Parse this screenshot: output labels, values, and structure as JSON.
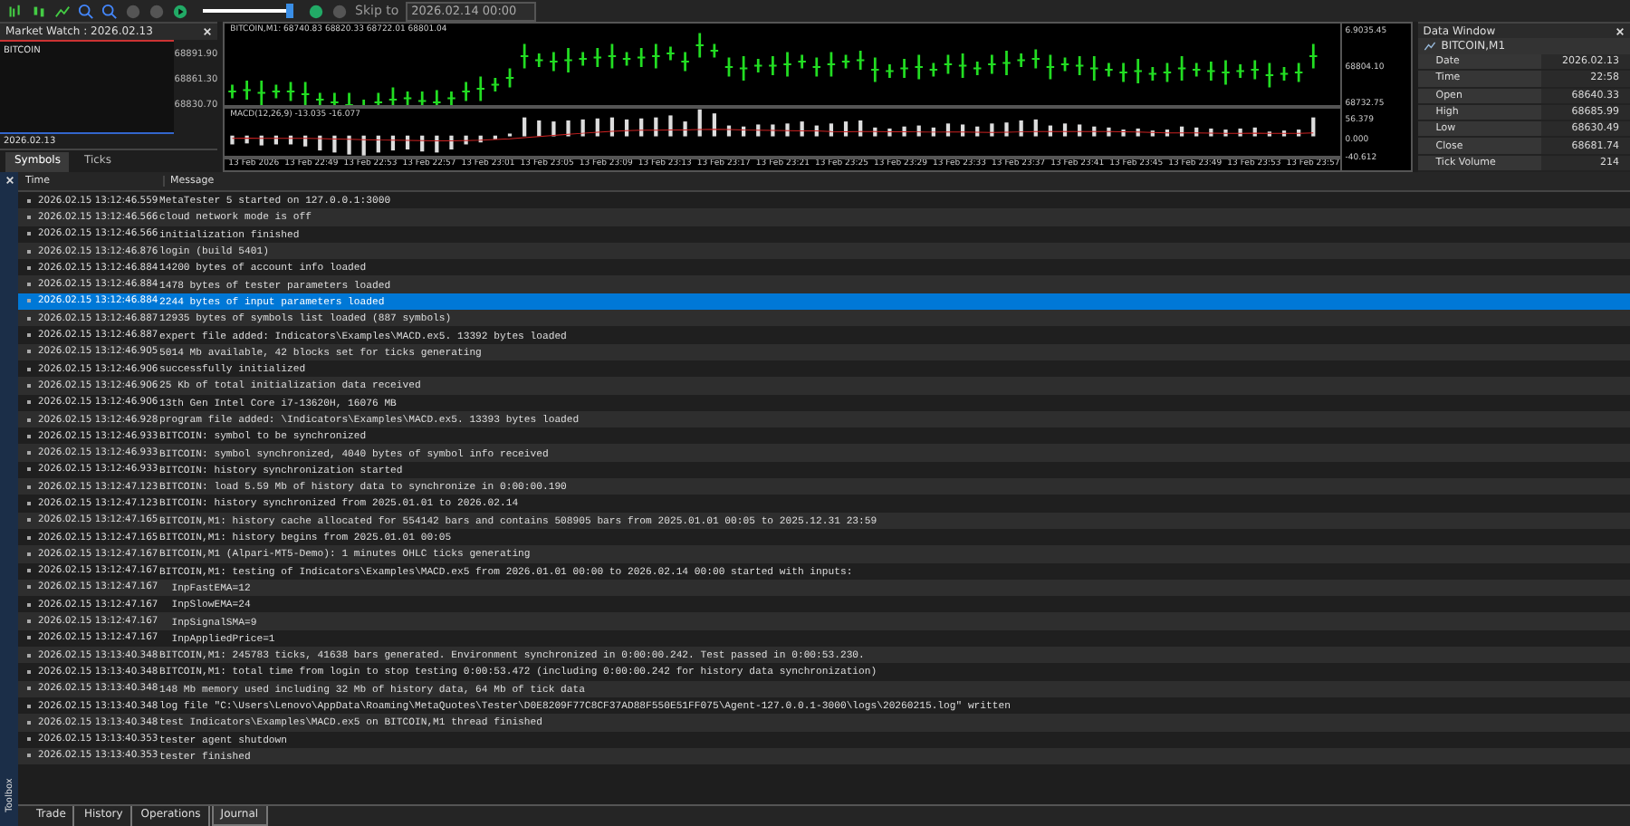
{
  "toolbar": {
    "slider": {
      "level": 0.95
    },
    "skip_label": "Skip to",
    "skip_date": "2026.02.14 00:00"
  },
  "market_watch": {
    "title": "Market Watch : 2026.02.13",
    "symbol": "BITCOIN",
    "prices": [
      "68891.90",
      "68861.30",
      "68830.70"
    ],
    "date": "2026.02.13",
    "tabs": [
      {
        "label": "Symbols",
        "selected": true
      },
      {
        "label": "Ticks",
        "selected": false
      }
    ]
  },
  "chart": {
    "header": "BITCOIN,M1: 68740.83 68820.33 68722.01 68801.04",
    "indicator": "MACD(12,26,9) -13.035 -16.077",
    "price_labels": [
      "6.9035.45",
      "68804.10",
      "68732.75"
    ],
    "macd_labels": [
      "56.379",
      "0.000",
      "-40.612"
    ],
    "time_labels": [
      "13 Feb 2026",
      "13 Feb 22:49",
      "13 Feb 22:53",
      "13 Feb 22:57",
      "13 Feb 23:01",
      "13 Feb 23:05",
      "13 Feb 23:09",
      "13 Feb 23:13",
      "13 Feb 23:17",
      "13 Feb 23:21",
      "13 Feb 23:25",
      "13 Feb 23:29",
      "13 Feb 23:33",
      "13 Feb 23:37",
      "13 Feb 23:41",
      "13 Feb 23:45",
      "13 Feb 23:49",
      "13 Feb 23:53",
      "13 Feb 23:57"
    ]
  },
  "data_window": {
    "title": "Data Window",
    "symbol": "BITCOIN,M1",
    "rows": [
      {
        "label": "Date",
        "value": "2026.02.13"
      },
      {
        "label": "Time",
        "value": "22:58"
      },
      {
        "label": "Open",
        "value": "68640.33"
      },
      {
        "label": "High",
        "value": "68685.99"
      },
      {
        "label": "Low",
        "value": "68630.49"
      },
      {
        "label": "Close",
        "value": "68681.74"
      },
      {
        "label": "Tick Volume",
        "value": "214"
      }
    ]
  },
  "journal": {
    "columns": [
      "Time",
      "Message"
    ],
    "rows": [
      {
        "time": "2026.02.15 13:12:46.559",
        "message": "MetaTester 5 started on 127.0.0.1:3000",
        "selected": false
      },
      {
        "time": "2026.02.15 13:12:46.566",
        "message": "cloud network mode is off",
        "selected": false
      },
      {
        "time": "2026.02.15 13:12:46.566",
        "message": "initialization finished",
        "selected": false
      },
      {
        "time": "2026.02.15 13:12:46.876",
        "message": "login (build 5401)",
        "selected": false
      },
      {
        "time": "2026.02.15 13:12:46.884",
        "message": "14200 bytes of account info loaded",
        "selected": false
      },
      {
        "time": "2026.02.15 13:12:46.884",
        "message": "1478 bytes of tester parameters loaded",
        "selected": false
      },
      {
        "time": "2026.02.15 13:12:46.884",
        "message": "2244 bytes of input parameters loaded",
        "selected": true
      },
      {
        "time": "2026.02.15 13:12:46.887",
        "message": "12935 bytes of symbols list loaded (887 symbols)",
        "selected": false
      },
      {
        "time": "2026.02.15 13:12:46.887",
        "message": "expert file added: Indicators\\Examples\\MACD.ex5. 13392 bytes loaded",
        "selected": false
      },
      {
        "time": "2026.02.15 13:12:46.905",
        "message": "5014 Mb available, 42 blocks set for ticks generating",
        "selected": false
      },
      {
        "time": "2026.02.15 13:12:46.906",
        "message": "successfully initialized",
        "selected": false
      },
      {
        "time": "2026.02.15 13:12:46.906",
        "message": "25 Kb of total initialization data received",
        "selected": false
      },
      {
        "time": "2026.02.15 13:12:46.906",
        "message": "13th Gen Intel Core i7-13620H, 16076 MB",
        "selected": false
      },
      {
        "time": "2026.02.15 13:12:46.928",
        "message": "program file added: \\Indicators\\Examples\\MACD.ex5. 13393 bytes loaded",
        "selected": false
      },
      {
        "time": "2026.02.15 13:12:46.933",
        "message": "BITCOIN: symbol to be synchronized",
        "selected": false
      },
      {
        "time": "2026.02.15 13:12:46.933",
        "message": "BITCOIN: symbol synchronized, 4040 bytes of symbol info received",
        "selected": false
      },
      {
        "time": "2026.02.15 13:12:46.933",
        "message": "BITCOIN: history synchronization started",
        "selected": false
      },
      {
        "time": "2026.02.15 13:12:47.123",
        "message": "BITCOIN: load 5.59 Mb of history data to synchronize in 0:00:00.190",
        "selected": false
      },
      {
        "time": "2026.02.15 13:12:47.123",
        "message": "BITCOIN: history synchronized from 2025.01.01 to 2026.02.14",
        "selected": false
      },
      {
        "time": "2026.02.15 13:12:47.165",
        "message": "BITCOIN,M1: history cache allocated for 554142 bars and contains 508905 bars from 2025.01.01 00:05 to 2025.12.31 23:59",
        "selected": false
      },
      {
        "time": "2026.02.15 13:12:47.165",
        "message": "BITCOIN,M1: history begins from 2025.01.01 00:05",
        "selected": false
      },
      {
        "time": "2026.02.15 13:12:47.167",
        "message": "BITCOIN,M1 (Alpari-MT5-Demo): 1 minutes OHLC ticks generating",
        "selected": false
      },
      {
        "time": "2026.02.15 13:12:47.167",
        "message": "BITCOIN,M1: testing of Indicators\\Examples\\MACD.ex5 from 2026.01.01 00:00 to 2026.02.14 00:00 started with inputs:",
        "selected": false
      },
      {
        "time": "2026.02.15 13:12:47.167",
        "message": "  InpFastEMA=12",
        "selected": false
      },
      {
        "time": "2026.02.15 13:12:47.167",
        "message": "  InpSlowEMA=24",
        "selected": false
      },
      {
        "time": "2026.02.15 13:12:47.167",
        "message": "  InpSignalSMA=9",
        "selected": false
      },
      {
        "time": "2026.02.15 13:12:47.167",
        "message": "  InpAppliedPrice=1",
        "selected": false
      },
      {
        "time": "2026.02.15 13:13:40.348",
        "message": "BITCOIN,M1: 245783 ticks, 41638 bars generated. Environment synchronized in 0:00:00.242. Test passed in 0:00:53.230.",
        "selected": false
      },
      {
        "time": "2026.02.15 13:13:40.348",
        "message": "BITCOIN,M1: total time from login to stop testing 0:00:53.472 (including 0:00:00.242 for history data synchronization)",
        "selected": false
      },
      {
        "time": "2026.02.15 13:13:40.348",
        "message": "148 Mb memory used including 32 Mb of history data, 64 Mb of tick data",
        "selected": false
      },
      {
        "time": "2026.02.15 13:13:40.348",
        "message": "log file \"C:\\Users\\Lenovo\\AppData\\Roaming\\MetaQuotes\\Tester\\D0E8209F77C8CF37AD88F550E51FF075\\Agent-127.0.0.1-3000\\logs\\20260215.log\" written",
        "selected": false
      },
      {
        "time": "2026.02.15 13:13:40.348",
        "message": "test Indicators\\Examples\\MACD.ex5 on BITCOIN,M1 thread finished",
        "selected": false
      },
      {
        "time": "2026.02.15 13:13:40.353",
        "message": "tester agent shutdown",
        "selected": false
      },
      {
        "time": "2026.02.15 13:13:40.353",
        "message": "tester finished",
        "selected": false
      }
    ]
  },
  "toolbox_label": "Toolbox",
  "bottom_tabs": [
    {
      "label": "Trade",
      "selected": false
    },
    {
      "label": "History",
      "selected": false
    },
    {
      "label": "Operations",
      "selected": false
    },
    {
      "label": "Journal",
      "selected": true
    }
  ]
}
